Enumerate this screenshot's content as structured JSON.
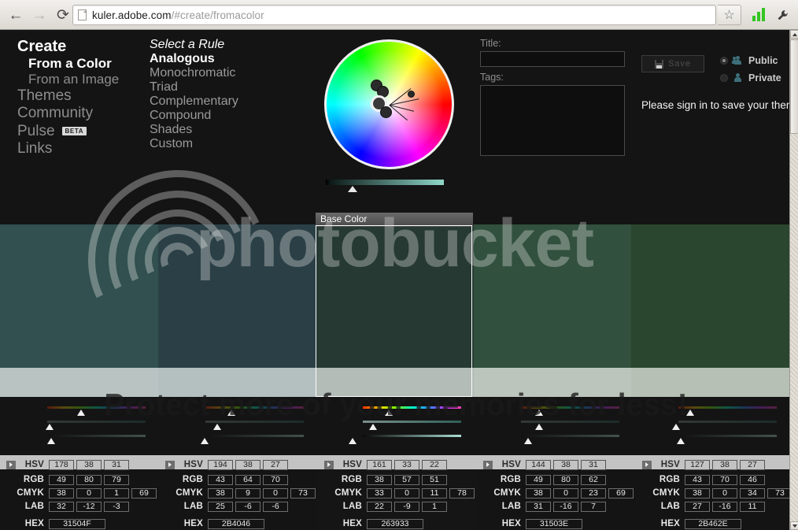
{
  "browser": {
    "back_icon": "back-arrow-icon",
    "forward_icon": "forward-arrow-icon",
    "reload_icon": "reload-icon",
    "url_domain": "kuler.adobe.com",
    "url_path": "/#create/fromacolor",
    "star_icon": "☆",
    "wrench_icon": "🔧"
  },
  "nav": {
    "items": [
      {
        "label": "Create",
        "level": "head"
      },
      {
        "label": "From a Color",
        "level": "sub-active"
      },
      {
        "label": "From an Image",
        "level": "sub"
      },
      {
        "label": "Themes",
        "level": "item"
      },
      {
        "label": "Community",
        "level": "item"
      },
      {
        "label": "Pulse",
        "level": "item",
        "badge": "BETA"
      },
      {
        "label": "Links",
        "level": "item"
      }
    ]
  },
  "rules": {
    "title": "Select a Rule",
    "options": [
      {
        "label": "Analogous",
        "selected": true
      },
      {
        "label": "Monochromatic",
        "selected": false
      },
      {
        "label": "Triad",
        "selected": false
      },
      {
        "label": "Complementary",
        "selected": false
      },
      {
        "label": "Compound",
        "selected": false
      },
      {
        "label": "Shades",
        "selected": false
      },
      {
        "label": "Custom",
        "selected": false
      }
    ]
  },
  "panel": {
    "title_label": "Title:",
    "title_value": "",
    "tags_label": "Tags:",
    "tags_value": "",
    "save_label": "Save",
    "visibility": [
      {
        "label": "Public",
        "selected": true
      },
      {
        "label": "Private",
        "selected": false
      }
    ],
    "signin_message": "Please sign in to save your theme."
  },
  "base_color_label": "Base Color",
  "watermark": {
    "brand": "photobucket",
    "tagline": "Protect more of your memories for less!"
  },
  "swatches": [
    {
      "hex_swatch": "#31504F",
      "low_hex": "#b9c4c2",
      "is_base": false,
      "rows": [
        {
          "label": "HSV",
          "values": [
            "178",
            "38",
            "31"
          ]
        },
        {
          "label": "RGB",
          "values": [
            "49",
            "80",
            "79"
          ]
        },
        {
          "label": "CMYK",
          "values": [
            "38",
            "0",
            "1",
            "69"
          ]
        },
        {
          "label": "LAB",
          "values": [
            "32",
            "-12",
            "-3"
          ]
        }
      ],
      "hex_label": "HEX",
      "hex_value": "31504F"
    },
    {
      "hex_swatch": "#2B4046",
      "low_hex": "#b4bfc0",
      "is_base": false,
      "rows": [
        {
          "label": "HSV",
          "values": [
            "194",
            "38",
            "27"
          ]
        },
        {
          "label": "RGB",
          "values": [
            "43",
            "64",
            "70"
          ]
        },
        {
          "label": "CMYK",
          "values": [
            "38",
            "9",
            "0",
            "73"
          ]
        },
        {
          "label": "LAB",
          "values": [
            "25",
            "-6",
            "-6"
          ]
        }
      ],
      "hex_label": "HEX",
      "hex_value": "2B4046"
    },
    {
      "hex_swatch": "#263933",
      "low_hex": "#b3bcb7",
      "is_base": true,
      "rows": [
        {
          "label": "HSV",
          "values": [
            "161",
            "33",
            "22"
          ]
        },
        {
          "label": "RGB",
          "values": [
            "38",
            "57",
            "51"
          ]
        },
        {
          "label": "CMYK",
          "values": [
            "33",
            "0",
            "11",
            "78"
          ]
        },
        {
          "label": "LAB",
          "values": [
            "22",
            "-9",
            "1"
          ]
        }
      ],
      "hex_label": "HEX",
      "hex_value": "263933"
    },
    {
      "hex_swatch": "#31503E",
      "low_hex": "#bcc5bc",
      "is_base": false,
      "rows": [
        {
          "label": "HSV",
          "values": [
            "144",
            "38",
            "31"
          ]
        },
        {
          "label": "RGB",
          "values": [
            "49",
            "80",
            "62"
          ]
        },
        {
          "label": "CMYK",
          "values": [
            "38",
            "0",
            "23",
            "69"
          ]
        },
        {
          "label": "LAB",
          "values": [
            "31",
            "-16",
            "7"
          ]
        }
      ],
      "hex_label": "HEX",
      "hex_value": "31503E"
    },
    {
      "hex_swatch": "#2B462E",
      "low_hex": "#b6c0b4",
      "is_base": false,
      "rows": [
        {
          "label": "HSV",
          "values": [
            "127",
            "38",
            "27"
          ]
        },
        {
          "label": "RGB",
          "values": [
            "43",
            "70",
            "46"
          ]
        },
        {
          "label": "CMYK",
          "values": [
            "38",
            "0",
            "34",
            "73"
          ]
        },
        {
          "label": "LAB",
          "values": [
            "27",
            "-16",
            "11"
          ]
        }
      ],
      "hex_label": "HEX",
      "hex_value": "2B462E"
    }
  ]
}
